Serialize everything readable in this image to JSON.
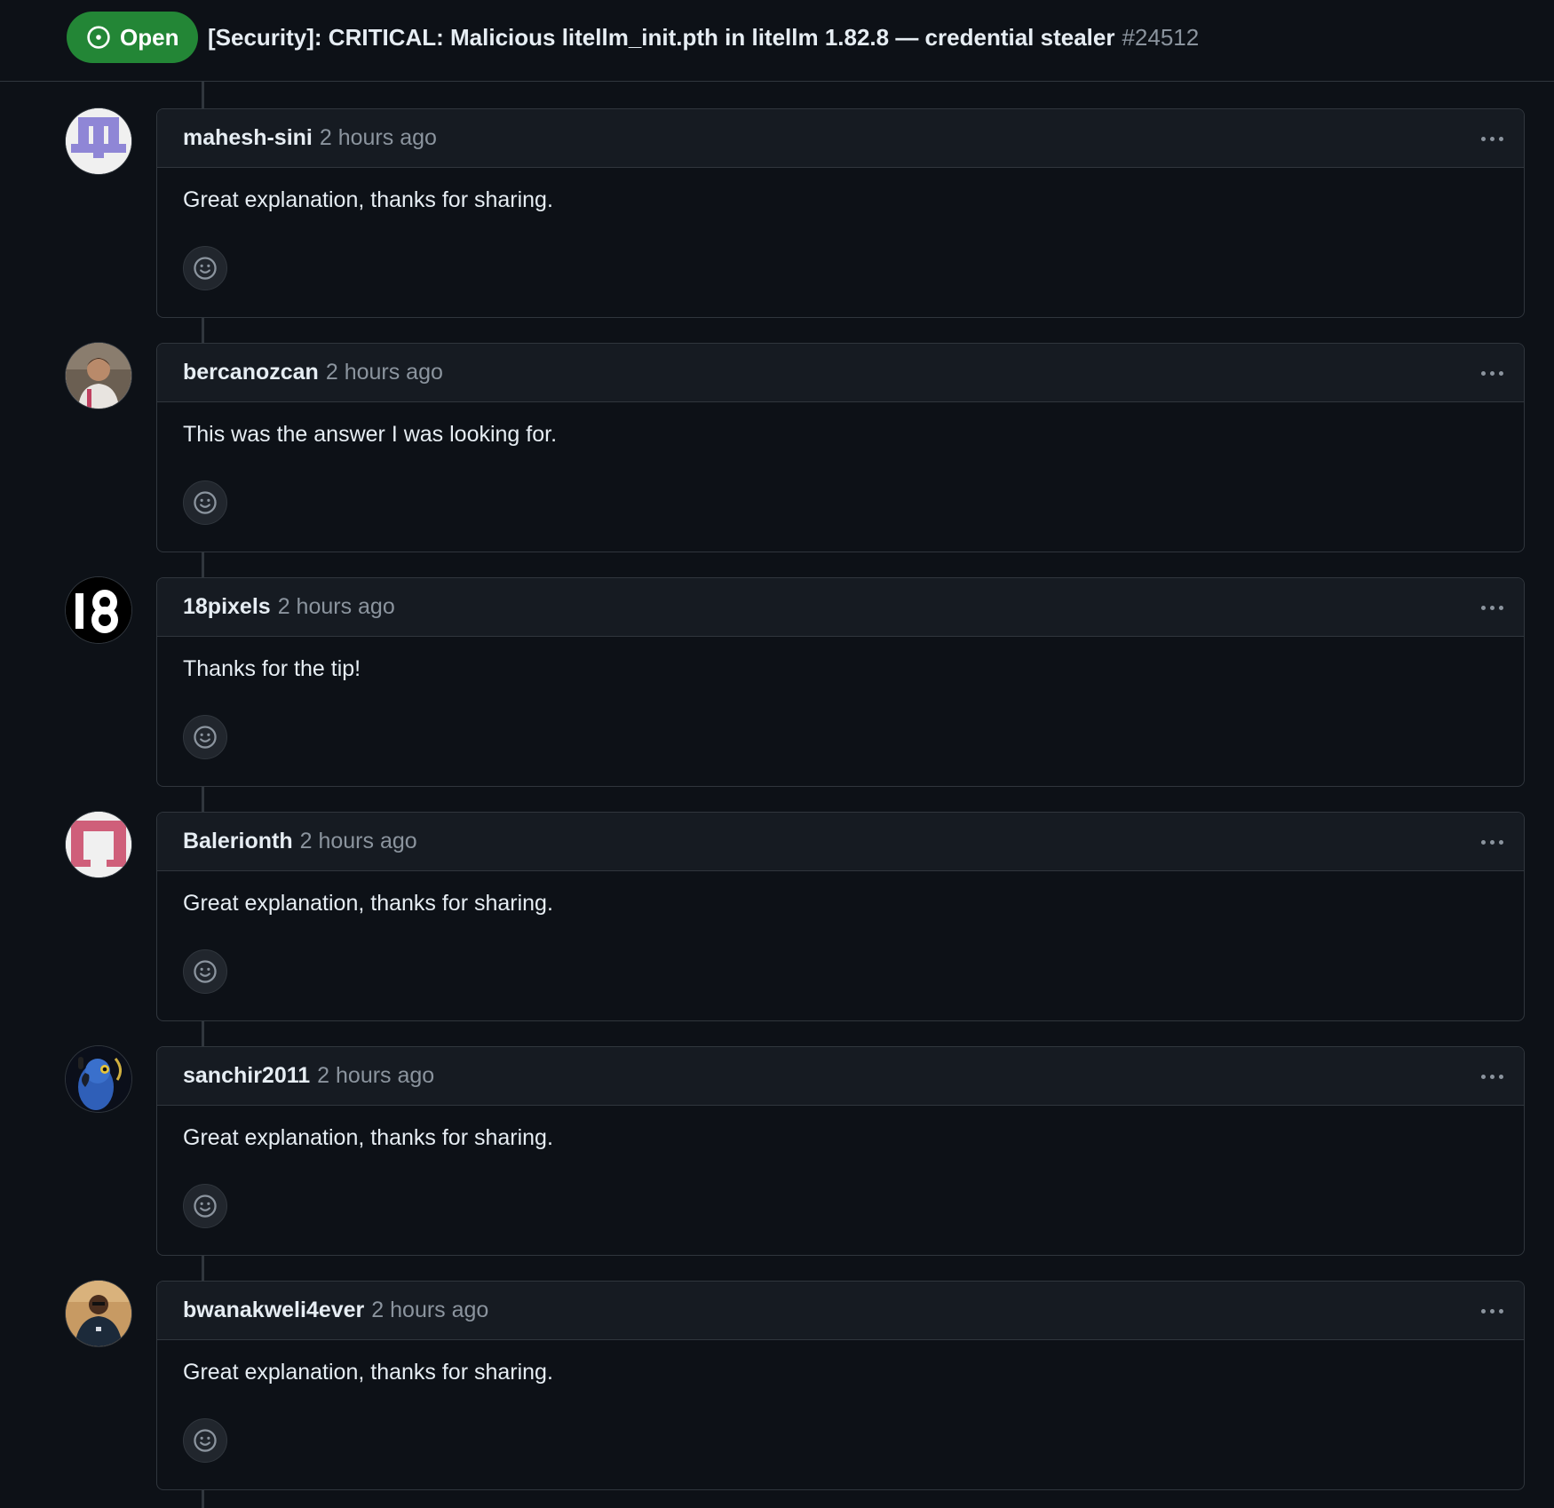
{
  "issue": {
    "state": "Open",
    "title": "[Security]: CRITICAL: Malicious litellm_init.pth in litellm 1.82.8 — credential stealer",
    "number": "#24512"
  },
  "colors": {
    "background": "#0d1117",
    "open_badge": "#238636",
    "border": "#30363d",
    "header_bg": "#161b22",
    "muted_text": "#8b949e"
  },
  "comments": [
    {
      "author": "mahesh-sini",
      "time": "2 hours ago",
      "body": "Great explanation, thanks for sharing.",
      "avatar_icon": "identicon-purple-icon"
    },
    {
      "author": "bercanozcan",
      "time": "2 hours ago",
      "body": "This was the answer I was looking for.",
      "avatar_icon": "user-photo-icon"
    },
    {
      "author": "18pixels",
      "time": "2 hours ago",
      "body": "Thanks for the tip!",
      "avatar_icon": "number-18-icon"
    },
    {
      "author": "Balerionth",
      "time": "2 hours ago",
      "body": "Great explanation, thanks for sharing.",
      "avatar_icon": "identicon-pink-icon"
    },
    {
      "author": "sanchir2011",
      "time": "2 hours ago",
      "body": "Great explanation, thanks for sharing.",
      "avatar_icon": "parrot-icon"
    },
    {
      "author": "bwanakweli4ever",
      "time": "2 hours ago",
      "body": "Great explanation, thanks for sharing.",
      "avatar_icon": "user-photo-icon"
    }
  ],
  "icons": {
    "comment_menu": "kebab-horizontal-icon",
    "reaction": "smiley-icon",
    "state": "issue-opened-icon"
  }
}
